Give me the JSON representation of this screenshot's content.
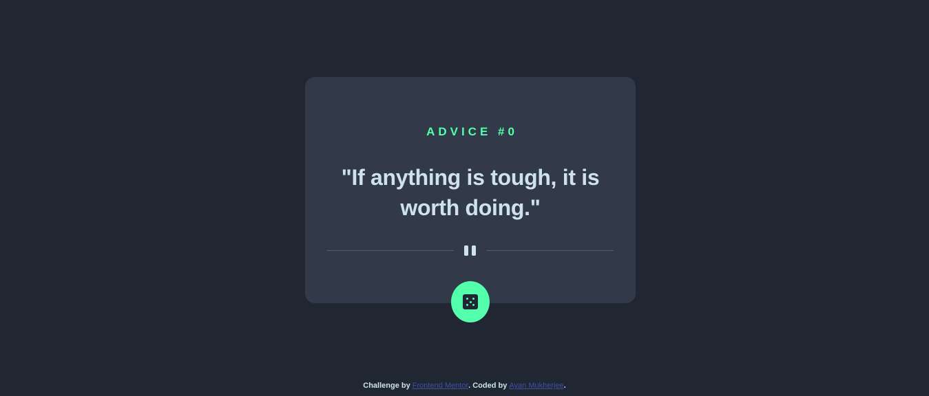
{
  "colors": {
    "background": "#202632",
    "card": "#323A49",
    "accent": "#53FFAA",
    "text": "#CEE3E9",
    "divider": "#4F5D74",
    "link": "#3E52A3"
  },
  "card": {
    "advice_label": "ADVICE #0",
    "advice_text": "\"If anything is tough, it is worth doing.\"",
    "divider_icon": "pause-icon",
    "button_icon": "dice-icon"
  },
  "footer": {
    "prefix": "Challenge by ",
    "link1": "Frontend Mentor",
    "middle": ". Coded by ",
    "link2": "Ayan Mukherjee",
    "suffix": "."
  }
}
